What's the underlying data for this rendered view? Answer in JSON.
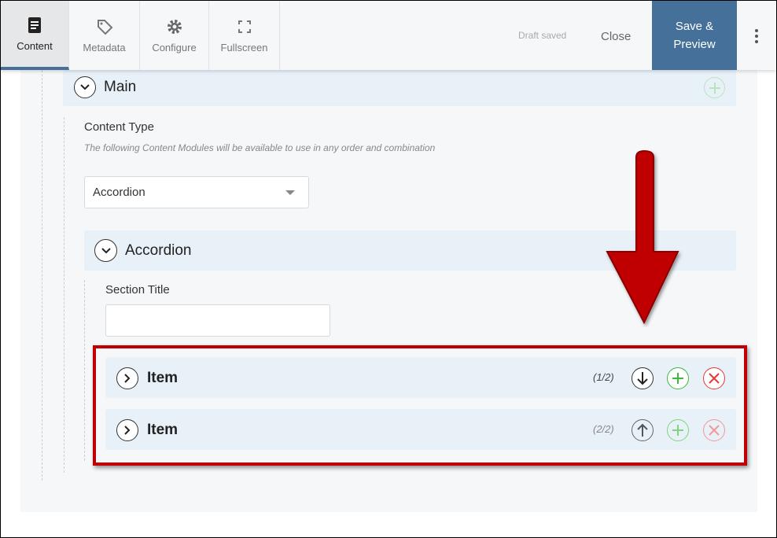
{
  "toolbar": {
    "tabs": [
      {
        "label": "Content",
        "icon": "document-icon",
        "active": true
      },
      {
        "label": "Metadata",
        "icon": "tag-icon"
      },
      {
        "label": "Configure",
        "icon": "gear-icon"
      },
      {
        "label": "Fullscreen",
        "icon": "fullscreen-icon"
      }
    ],
    "status": "Draft saved",
    "close_label": "Close",
    "save_label_1": "Save &",
    "save_label_2": "Preview",
    "more_icon": "kebab-icon"
  },
  "main": {
    "section_title": "Main",
    "content_type_label": "Content Type",
    "content_type_help": "The following Content Modules will be available to use in any order and combination",
    "content_type_value": "Accordion",
    "accordion": {
      "title": "Accordion",
      "section_title_label": "Section Title",
      "section_title_value": "",
      "items": [
        {
          "title": "Item",
          "position": "(1/2)",
          "move": "down"
        },
        {
          "title": "Item",
          "position": "(2/2)",
          "move": "up"
        }
      ]
    }
  },
  "colors": {
    "accent": "#44709a",
    "annotation": "#c00000",
    "add": "#3cb83c",
    "remove": "#e53935"
  }
}
